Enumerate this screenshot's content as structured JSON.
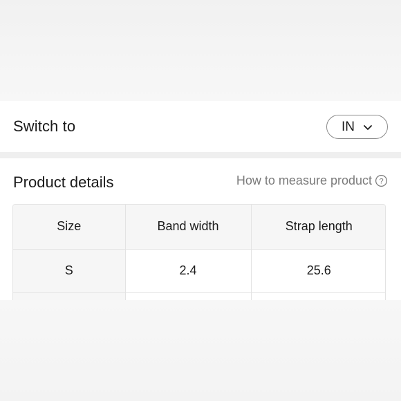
{
  "unit_switch": {
    "title": "Switch to",
    "selected_unit": "IN"
  },
  "product_details": {
    "title": "Product details",
    "measure_link": "How to measure product",
    "table": {
      "headers": [
        "Size",
        "Band width",
        "Strap length"
      ],
      "rows": [
        [
          "S",
          "2.4",
          "25.6"
        ],
        [
          "",
          "",
          ""
        ]
      ]
    }
  },
  "icons": {
    "unit_chevron": "chevron-down-icon",
    "measure_help": "question-circle-icon"
  }
}
